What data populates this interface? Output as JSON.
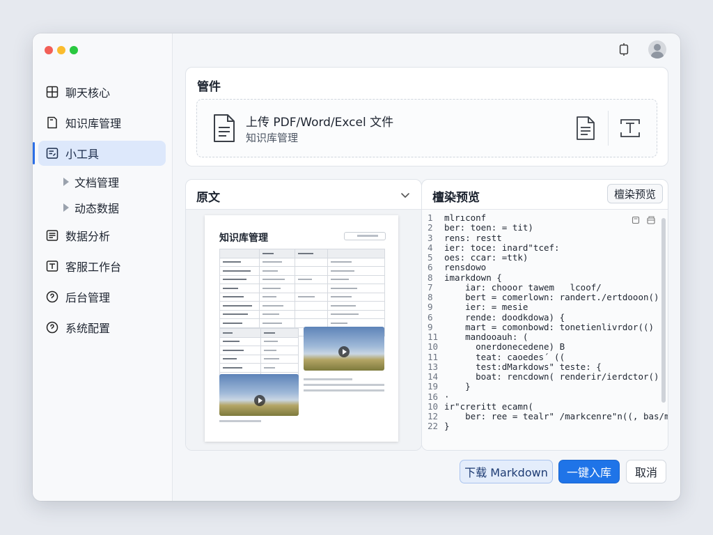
{
  "window": {
    "traffic_colors": [
      "#f25f57",
      "#fbbc2e",
      "#2ac840"
    ]
  },
  "sidebar": {
    "items": [
      {
        "label": "聊天核心",
        "icon": "grid-icon"
      },
      {
        "label": "知识库管理",
        "icon": "notebook-icon"
      },
      {
        "label": "小工具",
        "icon": "tools-card-icon",
        "active": true
      },
      {
        "label": "数据分析",
        "icon": "list-card-icon"
      },
      {
        "label": "客服工作台",
        "icon": "text-card-icon"
      },
      {
        "label": "后台管理",
        "icon": "circle-help-icon"
      },
      {
        "label": "系统配置",
        "icon": "circle-help-icon"
      }
    ],
    "sub_items": [
      {
        "label": "文档管理"
      },
      {
        "label": "动态数据"
      }
    ]
  },
  "header": {
    "icons": [
      "device-icon",
      "avatar"
    ]
  },
  "upload": {
    "title": "管件",
    "dropzone_title": "上传 PDF/Word/Excel 文件",
    "dropzone_sub": "知识库管理"
  },
  "source": {
    "title": "原文",
    "doc_title": "知识库管理"
  },
  "preview": {
    "title": "檀染预览",
    "button_label": "檀染预览",
    "code": [
      {
        "n": "1",
        "t": "mlrıconf"
      },
      {
        "n": "2",
        "t": "ber: toen: = tit)"
      },
      {
        "n": "3",
        "t": "rens: restt"
      },
      {
        "n": "4",
        "t": "ier: toce: inard\"tcef:"
      },
      {
        "n": "5",
        "t": "oes: ccar: =ttk)"
      },
      {
        "n": "6",
        "t": "rensdowo"
      },
      {
        "n": "8",
        "t": "imarkdown {"
      },
      {
        "n": "7",
        "t": "    iar: chooor tawem   lcoof/"
      },
      {
        "n": "8",
        "t": "    bert = comerlown: randert./ertdooon()"
      },
      {
        "n": "9",
        "t": "    ier: = mesie"
      },
      {
        "n": "6",
        "t": "    rende: doodkdowa) {"
      },
      {
        "n": "9",
        "t": "    mart = comonbowd: tonetienlivrdor(()"
      },
      {
        "n": "11",
        "t": "    mandooauh: ("
      },
      {
        "n": "10",
        "t": "      onerdonecedene) B"
      },
      {
        "n": "11",
        "t": "      teat: caoedes´ (("
      },
      {
        "n": "13",
        "t": "      test:dMarkdows\" teste: {"
      },
      {
        "n": "14",
        "t": "      boat: rencdown( renderir/ierdctor()"
      },
      {
        "n": "19",
        "t": "    }"
      },
      {
        "n": "16",
        "t": "·"
      },
      {
        "n": "10",
        "t": "ir\"creritt ecamn("
      },
      {
        "n": "12",
        "t": "    ber: ree = tealr\" /markcenre\"n((, bas/maet/'"
      },
      {
        "n": "22",
        "t": "}"
      }
    ]
  },
  "actions": {
    "download": "下载 Markdown",
    "save": "一键入库",
    "cancel": "取消"
  },
  "colors": {
    "accent": "#1f74e8",
    "active_bg": "#dde8fb"
  }
}
